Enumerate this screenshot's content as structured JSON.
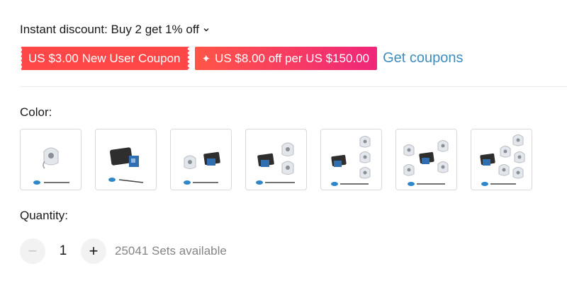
{
  "discount": {
    "text": "Instant discount: Buy 2 get 1% off"
  },
  "coupons": {
    "new_user": "US $3.00 New User Coupon",
    "store": "US $8.00 off per US $150.00",
    "get_coupons": "Get coupons"
  },
  "color": {
    "label": "Color:",
    "options": [
      {
        "name": "remote-only"
      },
      {
        "name": "receiver-only"
      },
      {
        "name": "receiver-1-remote"
      },
      {
        "name": "receiver-2-remotes"
      },
      {
        "name": "receiver-3-remotes"
      },
      {
        "name": "receiver-4-remotes"
      },
      {
        "name": "receiver-5-remotes"
      }
    ]
  },
  "quantity": {
    "label": "Quantity:",
    "minus": "−",
    "value": "1",
    "plus": "+",
    "available": "25041 Sets available"
  },
  "colors": {
    "accent_red": "#ff4747",
    "link_blue": "#3e8dbf",
    "receiver_blue": "#2f86c8"
  }
}
